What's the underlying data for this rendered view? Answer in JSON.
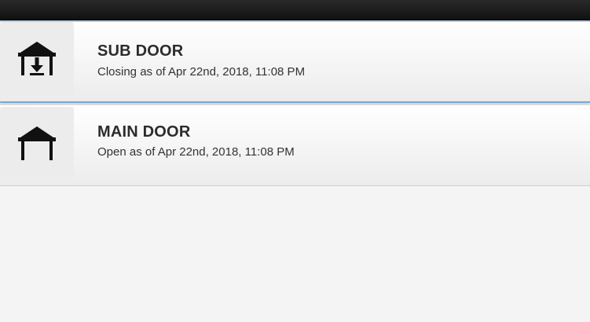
{
  "doors": [
    {
      "name": "SUB DOOR",
      "status": "Closing as of Apr 22nd, 2018, 11:08 PM",
      "icon": "garage-closing-icon"
    },
    {
      "name": "MAIN DOOR",
      "status": "Open as of Apr 22nd, 2018, 11:08 PM",
      "icon": "garage-open-icon"
    }
  ]
}
